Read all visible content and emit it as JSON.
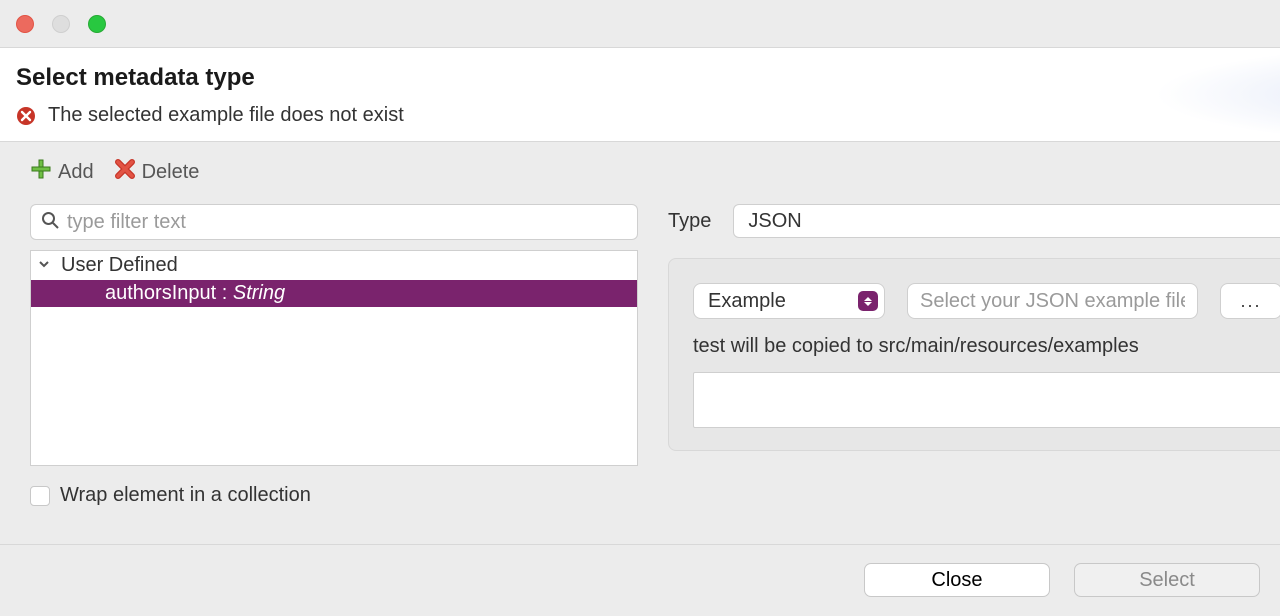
{
  "header": {
    "title": "Select metadata type",
    "error": "The selected example file does not exist"
  },
  "toolbar": {
    "add_label": "Add",
    "delete_label": "Delete"
  },
  "filter": {
    "placeholder": "type filter text"
  },
  "tree": {
    "group_label": "User Defined",
    "items": [
      {
        "name": "authorsInput",
        "type": "String"
      }
    ]
  },
  "wrap_checkbox": {
    "label": "Wrap element in a collection",
    "checked": false
  },
  "type_field": {
    "label": "Type",
    "value": "JSON"
  },
  "example_panel": {
    "mode_value": "Example",
    "file_placeholder": "Select your JSON example file",
    "browse_label": "...",
    "hint": "test will be copied to src/main/resources/examples"
  },
  "footer": {
    "close_label": "Close",
    "select_label": "Select"
  }
}
